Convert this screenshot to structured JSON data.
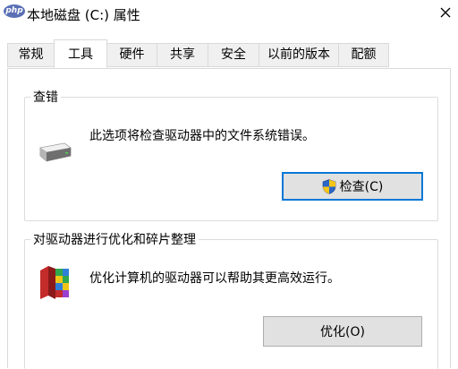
{
  "window": {
    "app_icon_label": "php",
    "title": "本地磁盘 (C:) 属性",
    "close_icon": "close-icon"
  },
  "tabs": [
    {
      "label": "常规",
      "active": false
    },
    {
      "label": "工具",
      "active": true
    },
    {
      "label": "硬件",
      "active": false
    },
    {
      "label": "共享",
      "active": false
    },
    {
      "label": "安全",
      "active": false
    },
    {
      "label": "以前的版本",
      "active": false
    },
    {
      "label": "配额",
      "active": false
    }
  ],
  "error_checking": {
    "title": "查错",
    "icon": "drive-icon",
    "description": "此选项将检查驱动器中的文件系统错误。",
    "button_label": "检查(C)",
    "button_icon": "uac-shield-icon"
  },
  "optimize": {
    "title": "对驱动器进行优化和碎片整理",
    "icon": "defrag-icon",
    "description": "优化计算机的驱动器可以帮助其更高效运行。",
    "button_label": "优化(O)"
  },
  "colors": {
    "accent": "#0078d7",
    "button_bg": "#e1e1e1",
    "border": "#dcdcdc"
  }
}
